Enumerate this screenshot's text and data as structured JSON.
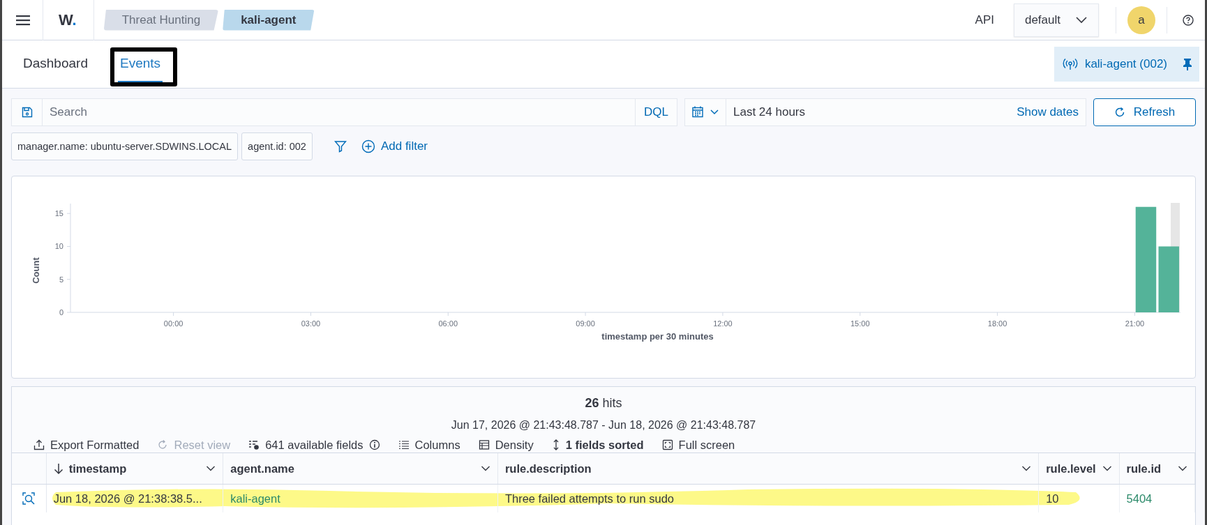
{
  "header": {
    "logo": "W.",
    "breadcrumbs": [
      {
        "label": "Threat Hunting",
        "selected": false
      },
      {
        "label": "kali-agent",
        "selected": true
      }
    ],
    "api_label": "API",
    "api_select": "default",
    "avatar": "a"
  },
  "tabs": [
    {
      "label": "Dashboard",
      "selected": false,
      "boxed": false
    },
    {
      "label": "Events",
      "selected": true,
      "boxed": true
    }
  ],
  "agent_badge": "kali-agent (002)",
  "query_bar": {
    "placeholder": "Search",
    "language": "DQL",
    "time_range": "Last 24 hours",
    "show_dates": "Show dates",
    "refresh": "Refresh"
  },
  "filters": [
    "manager.name: ubuntu-server.SDWINS.LOCAL",
    "agent.id: 002"
  ],
  "add_filter": "Add filter",
  "histogram": {
    "chart_data": {
      "type": "bar",
      "xlabel": "timestamp per 30 minutes",
      "ylabel": "Count",
      "x": [
        21.25,
        21.75
      ],
      "values": [
        16,
        10
      ],
      "xlim": [
        -2.25,
        22.0
      ],
      "ylim": [
        0,
        16.5
      ],
      "yticks": [
        0,
        5,
        10,
        15
      ],
      "xticks": [
        {
          "value": 0,
          "label": "00:00"
        },
        {
          "value": 3,
          "label": "03:00"
        },
        {
          "value": 6,
          "label": "06:00"
        },
        {
          "value": 9,
          "label": "09:00"
        },
        {
          "value": 12,
          "label": "12:00"
        },
        {
          "value": 15,
          "label": "15:00"
        },
        {
          "value": 18,
          "label": "18:00"
        },
        {
          "value": 21,
          "label": "21:00"
        }
      ]
    }
  },
  "results": {
    "hits_count": "26",
    "hits_label": "hits",
    "range": "Jun 17, 2026 @ 21:43:48.787 - Jun 18, 2026 @ 21:43:48.787",
    "toolbar": [
      {
        "kind": "export",
        "label": "Export Formatted",
        "disabled": false
      },
      {
        "kind": "reset",
        "label": "Reset view",
        "disabled": true
      },
      {
        "kind": "fields",
        "label": "641 available fields",
        "disabled": false
      },
      {
        "kind": "columns",
        "label": "Columns",
        "disabled": false
      },
      {
        "kind": "density",
        "label": "Density",
        "disabled": false
      },
      {
        "kind": "sort",
        "label": "1 fields sorted",
        "disabled": false
      },
      {
        "kind": "fullscreen",
        "label": "Full screen",
        "disabled": false
      }
    ],
    "columns": [
      {
        "label": "timestamp",
        "sorted": true
      },
      {
        "label": "agent.name",
        "sorted": false
      },
      {
        "label": "rule.description",
        "sorted": false
      },
      {
        "label": "rule.level",
        "sorted": false
      },
      {
        "label": "rule.id",
        "sorted": false
      }
    ],
    "rows": [
      {
        "cells": [
          {
            "text": "Jun 18, 2026 @ 21:38:38.5...",
            "link": false
          },
          {
            "text": "kali-agent",
            "link": true
          },
          {
            "text": "Three failed attempts to run sudo",
            "link": false
          },
          {
            "text": "10",
            "link": false
          },
          {
            "text": "5404",
            "link": true
          }
        ],
        "highlighted": true
      }
    ]
  }
}
